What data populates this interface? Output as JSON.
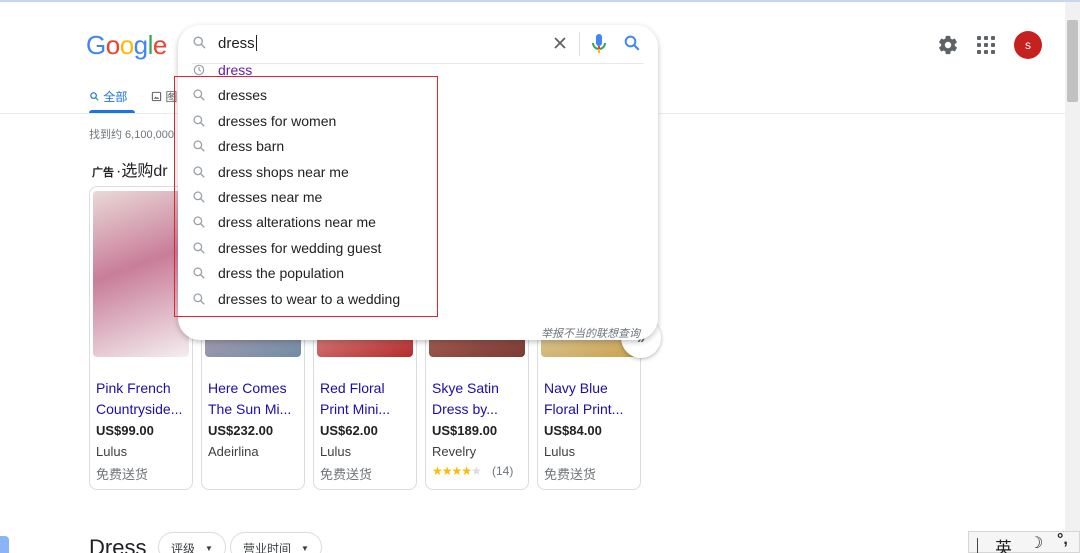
{
  "logo": {
    "text": [
      "G",
      "o",
      "o",
      "g",
      "l",
      "e"
    ],
    "colors": [
      "#4285f4",
      "#ea4335",
      "#fbbc05",
      "#4285f4",
      "#34a853",
      "#ea4335"
    ]
  },
  "search": {
    "query": "dress",
    "suggestions": [
      {
        "text": "dress",
        "icon": "history-icon",
        "visited": true
      },
      {
        "text": "dresses",
        "icon": "search-icon"
      },
      {
        "text": "dresses for women",
        "icon": "search-icon"
      },
      {
        "text": "dress barn",
        "icon": "search-icon"
      },
      {
        "text": "dress shops near me",
        "icon": "search-icon"
      },
      {
        "text": "dresses near me",
        "icon": "search-icon"
      },
      {
        "text": "dress alterations near me",
        "icon": "search-icon"
      },
      {
        "text": "dresses for wedding guest",
        "icon": "search-icon"
      },
      {
        "text": "dress the population",
        "icon": "search-icon"
      },
      {
        "text": "dresses to wear to a wedding",
        "icon": "search-icon"
      }
    ],
    "report_text": "举报不当的联想查询"
  },
  "tabs": {
    "all": "全部",
    "images": "图"
  },
  "result_stats": "找到约 6,100,000",
  "ads": {
    "ad_label": "广告",
    "separator": "·",
    "heading": "选购dr",
    "products": [
      {
        "title1": "Pink French",
        "title2": "Countryside...",
        "price": "US$99.00",
        "store": "Lulus",
        "shipping": "免费送货",
        "colors": [
          "#e9d9d8",
          "#c97d99",
          "#f4eef0"
        ]
      },
      {
        "title1": "Here Comes",
        "title2": "The Sun Mi...",
        "price": "US$232.00",
        "store": "Adeirlina",
        "shipping": "",
        "colors": [
          "#9fb5c9",
          "#d8a7b7",
          "#6f8da6"
        ]
      },
      {
        "title1": "Red Floral",
        "title2": "Print Mini...",
        "price": "US$62.00",
        "store": "Lulus",
        "shipping": "免费送货",
        "colors": [
          "#d9534f",
          "#f2c4c0",
          "#b52b2b"
        ]
      },
      {
        "title1": "Skye Satin",
        "title2": "Dress by...",
        "price": "US$189.00",
        "store": "Revelry",
        "rating": 3.5,
        "reviews": "(14)",
        "colors": [
          "#a8574b",
          "#c97a6e",
          "#7b3a33"
        ]
      },
      {
        "title1": "Navy Blue",
        "title2": "Floral Print...",
        "price": "US$84.00",
        "store": "Lulus",
        "shipping": "免费送货",
        "colors": [
          "#2c4a7a",
          "#e9e4da",
          "#c9a24b"
        ]
      }
    ]
  },
  "local": {
    "heading": "Dress",
    "chips": [
      "评级",
      "营业时间"
    ]
  },
  "account": {
    "initial": "s",
    "avatar_color": "#c5221f"
  },
  "ime": {
    "lang": "英",
    "moon": "☽",
    "punct": "°,"
  }
}
